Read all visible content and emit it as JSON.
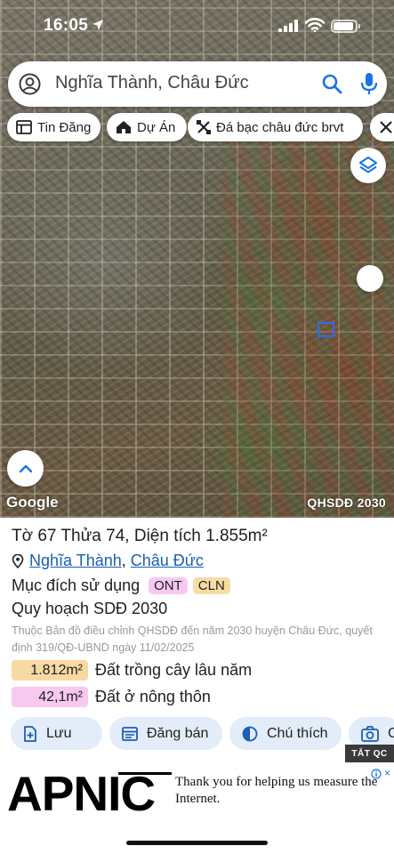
{
  "status_bar": {
    "time": "16:05"
  },
  "search": {
    "query": "Nghĩa Thành, Châu Đức"
  },
  "chips": [
    {
      "label": "Tin Đăng",
      "icon": "listing-icon"
    },
    {
      "label": "Dự Án",
      "icon": "house-icon"
    },
    {
      "label": "Đá bạc châu đức brvt",
      "icon": "tools-icon"
    }
  ],
  "map": {
    "attribution": "Google",
    "overlay_label": "QHSDĐ 2030"
  },
  "parcel": {
    "title": "Tờ 67 Thửa 74, Diện tích 1.855m²",
    "location": {
      "commune": "Nghĩa Thành",
      "separator": ",",
      "district": "Châu Đức"
    },
    "purpose_label": "Mục đích sử dụng",
    "purpose_tags": [
      "ONT",
      "CLN"
    ],
    "plan_title": "Quy hoạch SDĐ 2030",
    "plan_description": "Thuộc Bản đồ điều chỉnh QHSDĐ đến năm 2030 huyện Châu Đức, quyết định 319/QĐ-UBND ngày 11/02/2025",
    "areas": [
      {
        "value": "1.812m²",
        "label": "Đất trồng cây lâu năm",
        "color": "#f9d9a3"
      },
      {
        "value": "42,1m²",
        "label": "Đất ở nông thôn",
        "color": "#f7c8f0"
      }
    ]
  },
  "actions": [
    {
      "label": "Lưu",
      "icon": "add-doc-icon"
    },
    {
      "label": "Đăng bán",
      "icon": "post-listing-icon"
    },
    {
      "label": "Chú thích",
      "icon": "contrast-icon"
    },
    {
      "label": "C",
      "icon": "camera-icon"
    }
  ],
  "ad_badge": "TẮT QC",
  "ad": {
    "brand": "APNIC",
    "text": "Thank you for helping us measure the Internet."
  },
  "colors": {
    "accent": "#1a5fb4",
    "button_bg": "#e3ecf9",
    "parcel_outline": "#2f6bff"
  }
}
